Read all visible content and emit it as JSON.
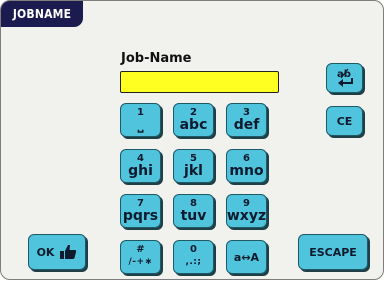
{
  "title": "JOBNAME",
  "job_label": "Job-Name",
  "job_value": "",
  "keys": [
    {
      "num": "1",
      "chars": "⎵"
    },
    {
      "num": "2",
      "chars": "abc"
    },
    {
      "num": "3",
      "chars": "def"
    },
    {
      "num": "4",
      "chars": "ghi"
    },
    {
      "num": "5",
      "chars": "jkl"
    },
    {
      "num": "6",
      "chars": "mno"
    },
    {
      "num": "7",
      "chars": "pqrs"
    },
    {
      "num": "8",
      "chars": "tuv"
    },
    {
      "num": "9",
      "chars": "wxyz"
    },
    {
      "num": "#",
      "chars": "/-+∗"
    },
    {
      "num": "0",
      "chars": ",.:;"
    }
  ],
  "case_toggle_label": "a↔A",
  "ce_label": "CE",
  "ok_label": "OK",
  "escape_label": "ESCAPE",
  "icons": {
    "backspace": "backspace-icon",
    "ok": "thumbs-up-icon"
  },
  "colors": {
    "title_bg": "#1b1b4f",
    "button": "#4fc4dc",
    "input": "#ffff22",
    "panel": "#f1f1ee"
  }
}
